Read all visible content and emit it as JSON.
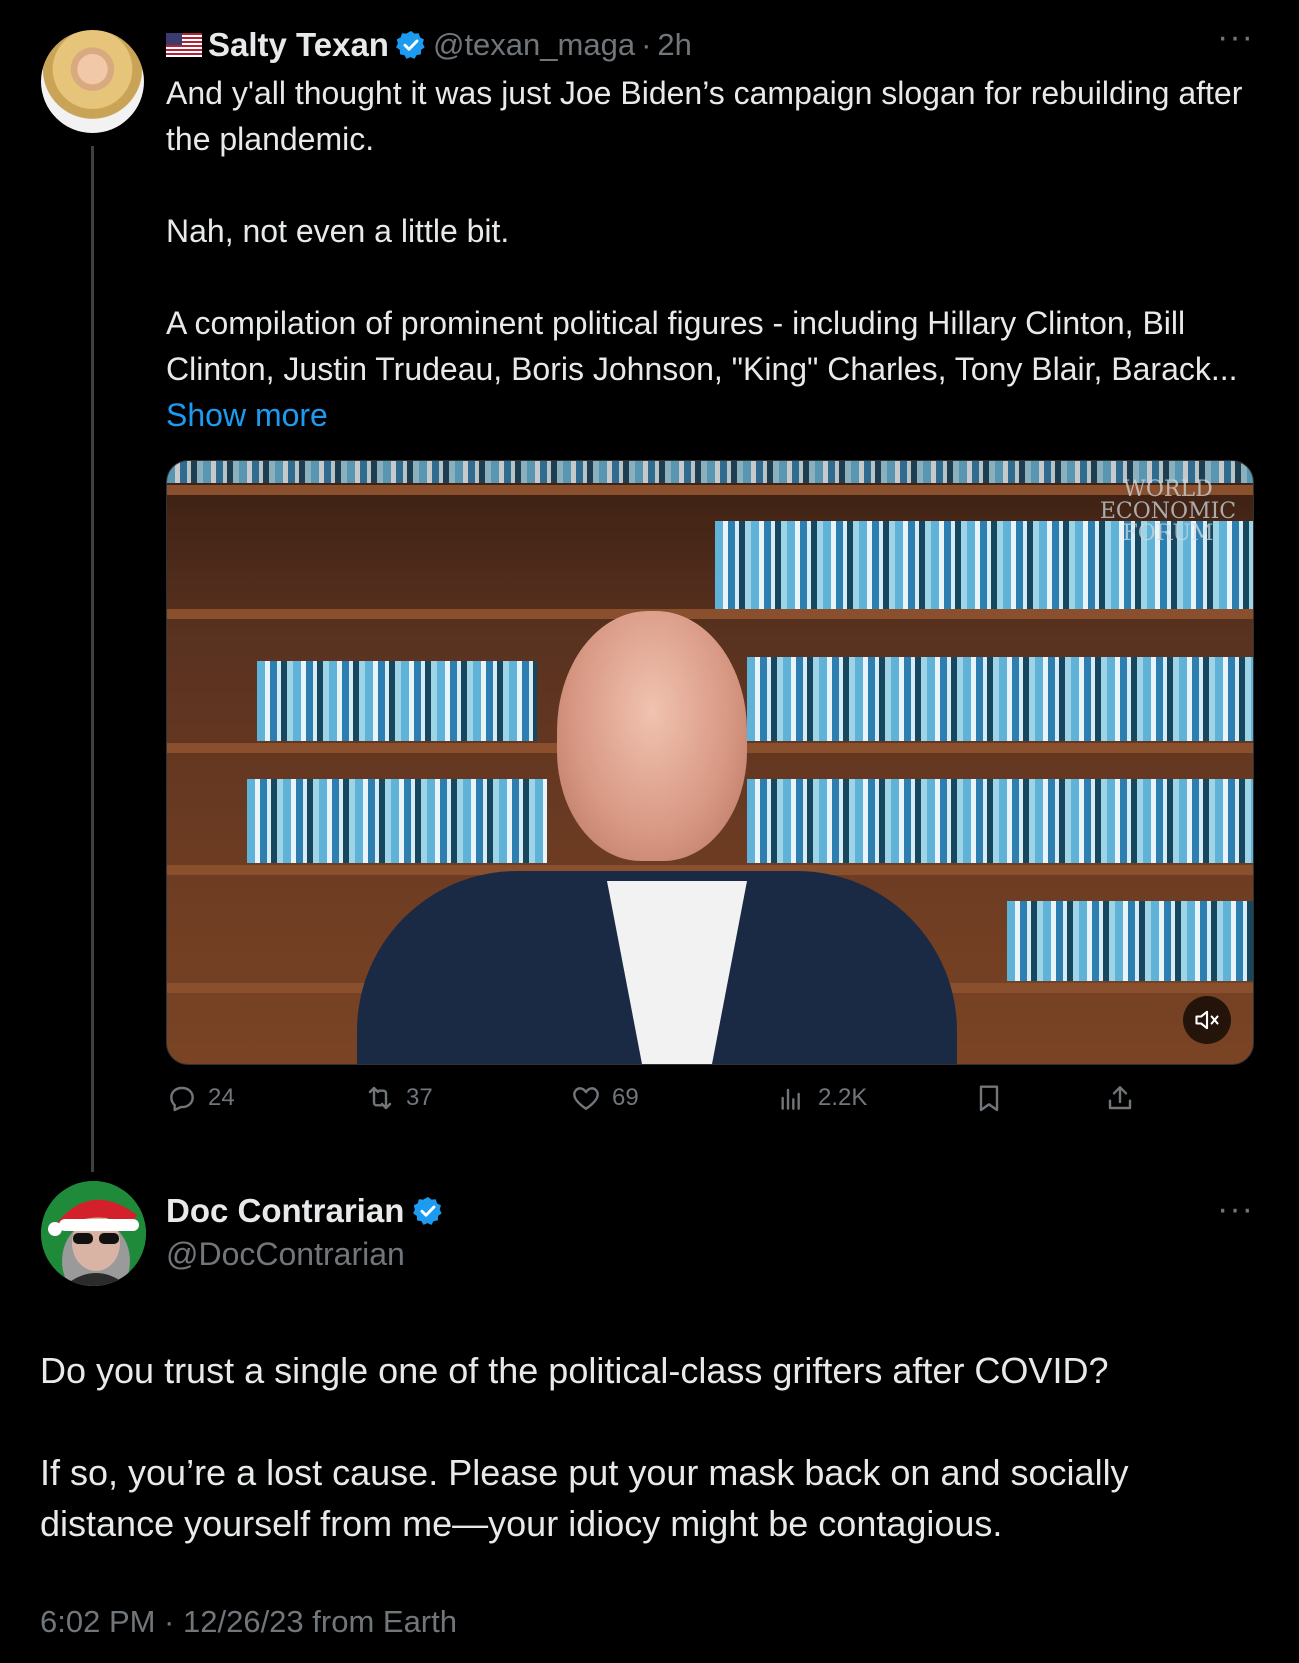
{
  "thread": {
    "parent": {
      "author": {
        "flag": "🇺🇸",
        "name": "Salty Texan",
        "handle": "@texan_maga",
        "time": "2h"
      },
      "text": {
        "p1": "And y'all thought it was just Joe Biden’s campaign slogan for rebuilding after the plandemic.",
        "p2": "Nah, not even a little bit.",
        "p3": "A compilation of prominent political figures - including Hillary Clinton, Bill Clinton, Justin Trudeau, Boris Johnson, \"King\" Charles, Tony Blair, Barack...",
        "show_more": "Show more"
      },
      "video": {
        "watermark_line1": "WORLD",
        "watermark_line2": "ECONOMIC",
        "watermark_line3": "FORUM",
        "muted": true,
        "mute_icon": "speaker-muted-icon"
      },
      "actions": {
        "replies": "24",
        "reposts": "37",
        "likes": "69",
        "views": "2.2K"
      }
    },
    "reply": {
      "author": {
        "name": "Doc Contrarian",
        "handle": "@DocContrarian"
      },
      "text": {
        "p1": "Do you trust a single one of the political-class grifters after COVID?",
        "p2": "If so, you’re a lost cause. Please put your mask back on and socially distance yourself from me—your idiocy might be contagious."
      },
      "meta": "6:02 PM · 12/26/23 from Earth"
    }
  },
  "colors": {
    "background": "#000000",
    "text": "#e7e9ea",
    "muted": "#71767b",
    "accent": "#1d9bf0"
  }
}
